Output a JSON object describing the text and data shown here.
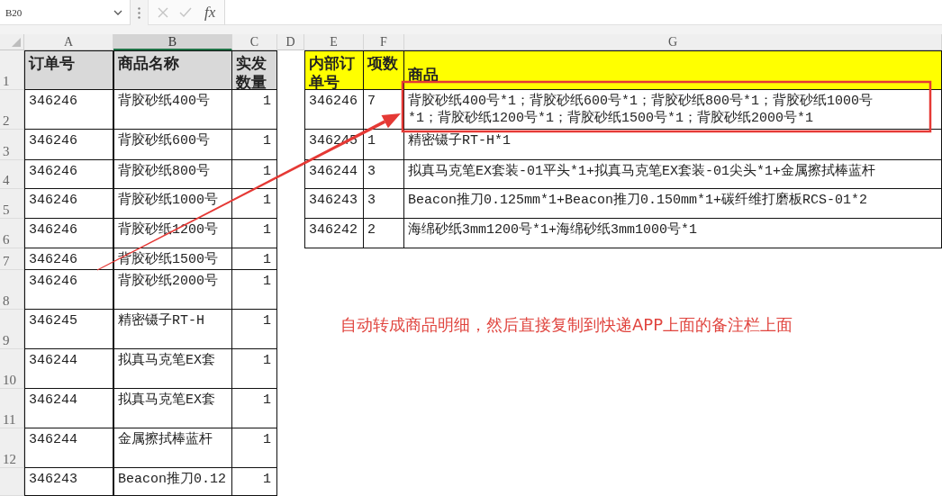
{
  "formula_bar": {
    "name_box": "B20",
    "function_label": "fx"
  },
  "columns": [
    {
      "letter": "A",
      "selected": false
    },
    {
      "letter": "B",
      "selected": true
    },
    {
      "letter": "C",
      "selected": false
    },
    {
      "letter": "D",
      "selected": false
    },
    {
      "letter": "E",
      "selected": false
    },
    {
      "letter": "F",
      "selected": false
    },
    {
      "letter": "G",
      "selected": false
    }
  ],
  "row_numbers": [
    "1",
    "2",
    "3",
    "4",
    "5",
    "6",
    "7",
    "8",
    "9",
    "10",
    "11",
    "12"
  ],
  "order_table": {
    "header": [
      "订单号",
      "商品名称",
      "实发数量"
    ],
    "rows": [
      [
        "346246",
        "背胶砂纸400号",
        "1"
      ],
      [
        "346246",
        "背胶砂纸600号",
        "1"
      ],
      [
        "346246",
        "背胶砂纸800号",
        "1"
      ],
      [
        "346246",
        "背胶砂纸1000号",
        "1"
      ],
      [
        "346246",
        "背胶砂纸1200号",
        "1"
      ],
      [
        "346246",
        "背胶砂纸1500号",
        "1"
      ],
      [
        "346246",
        "背胶砂纸2000号",
        "1"
      ],
      [
        "346245",
        "精密镊子RT-H",
        "1"
      ],
      [
        "346244",
        "拟真马克笔EX套",
        "1"
      ],
      [
        "346244",
        "拟真马克笔EX套",
        "1"
      ],
      [
        "346244",
        "金属擦拭棒蓝杆",
        "1"
      ],
      [
        "346243",
        "Beacon推刀0.12",
        "1"
      ]
    ]
  },
  "summary_table": {
    "header": [
      "内部订单号",
      "项数",
      "商品"
    ],
    "rows": [
      [
        "346246",
        "7",
        "背胶砂纸400号*1；背胶砂纸600号*1；背胶砂纸800号*1；背胶砂纸1000号*1；背胶砂纸1200号*1；背胶砂纸1500号*1；背胶砂纸2000号*1"
      ],
      [
        "346245",
        "1",
        "精密镊子RT-H*1"
      ],
      [
        "346244",
        "3",
        "拟真马克笔EX套装-01平头*1+拟真马克笔EX套装-01尖头*1+金属擦拭棒蓝杆"
      ],
      [
        "346243",
        "3",
        "Beacon推刀0.125mm*1+Beacon推刀0.150mm*1+碳纤维打磨板RCS-01*2"
      ],
      [
        "346242",
        "2",
        "海绵砂纸3mm1200号*1+海绵砂纸3mm1000号*1"
      ]
    ]
  },
  "annotation": {
    "text": "自动转成商品明细，然后直接复制到快递APP上面的备注栏上面"
  }
}
